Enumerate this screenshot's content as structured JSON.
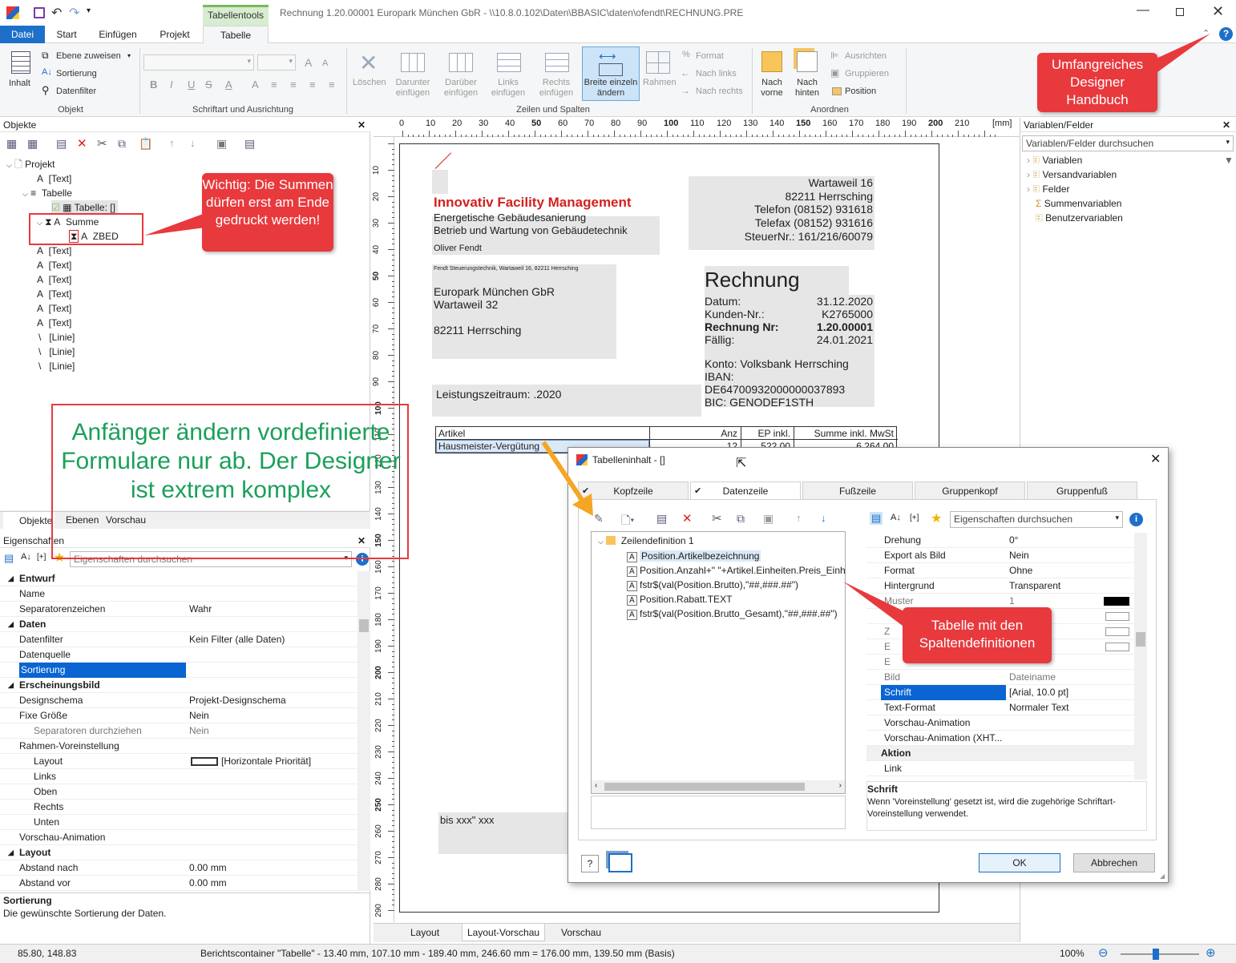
{
  "window": {
    "title": "Rechnung 1.20.00001 Europark München GbR - \\\\10.8.0.102\\Daten\\BBASIC\\daten\\ofendt\\RECHNUNG.PRE",
    "contextual_tab": "Tabellentools"
  },
  "ribbon_tabs": [
    "Datei",
    "Start",
    "Einfügen",
    "Projekt",
    "Tabelle"
  ],
  "ribbon": {
    "objekt": {
      "group": "Objekt",
      "inhalt": "Inhalt",
      "ebene": "Ebene zuweisen",
      "sortierung": "Sortierung",
      "datenfilter": "Datenfilter"
    },
    "schrift": {
      "group": "Schriftart und Ausrichtung",
      "bold": "B",
      "italic": "I",
      "underline": "U",
      "strike": "S",
      "fontcolor": "A",
      "grow": "A",
      "shrink": "A"
    },
    "zeilen": {
      "group": "Zeilen und Spalten",
      "loeschen": "Löschen",
      "darunter": "Darunter einfügen",
      "darueber": "Darüber einfügen",
      "links": "Links einfügen",
      "rechts": "Rechts einfügen",
      "breite": "Breite einzeln ändern",
      "rahmen": "Rahmen",
      "format": "Format",
      "nachlinks": "Nach links",
      "nachrechts": "Nach rechts"
    },
    "anordnen": {
      "group": "Anordnen",
      "vorne": "Nach vorne",
      "hinten": "Nach hinten",
      "ausrichten": "Ausrichten",
      "gruppieren": "Gruppieren",
      "position": "Position"
    }
  },
  "objects_panel": {
    "title": "Objekte",
    "tree": [
      "Projekt",
      "[Text]",
      "Tabelle",
      "Tabelle: []",
      "Summe",
      "ZBED",
      "[Text]",
      "[Text]",
      "[Text]",
      "[Text]",
      "[Text]",
      "[Text]",
      "[Linie]",
      "[Linie]",
      "[Linie]"
    ],
    "tabs": [
      "Objekte",
      "Ebenen",
      "Vorschau"
    ]
  },
  "props_panel": {
    "title": "Eigenschaften",
    "search": "Eigenschaften durchsuchen",
    "rows": [
      {
        "k": "Entwurf",
        "v": "",
        "cat": true
      },
      {
        "k": "Name",
        "v": ""
      },
      {
        "k": "Separatorenzeichen",
        "v": "Wahr"
      },
      {
        "k": "Daten",
        "v": "",
        "cat": true
      },
      {
        "k": "Datenfilter",
        "v": "Kein Filter (alle Daten)"
      },
      {
        "k": "Datenquelle",
        "v": ""
      },
      {
        "k": "Sortierung",
        "v": "",
        "sel": true
      },
      {
        "k": "Erscheinungsbild",
        "v": "",
        "cat": true
      },
      {
        "k": "Designschema",
        "v": "Projekt-Designschema"
      },
      {
        "k": "Fixe Größe",
        "v": "Nein"
      },
      {
        "k": "Separatoren durchziehen",
        "v": "Nein",
        "sub": true
      },
      {
        "k": "Rahmen-Voreinstellung",
        "v": ""
      },
      {
        "k": "Layout",
        "v": "[Horizontale Priorität]",
        "sub": true
      },
      {
        "k": "Links",
        "v": "",
        "sub": true
      },
      {
        "k": "Oben",
        "v": "",
        "sub": true
      },
      {
        "k": "Rechts",
        "v": "",
        "sub": true
      },
      {
        "k": "Unten",
        "v": "",
        "sub": true
      },
      {
        "k": "Vorschau-Animation",
        "v": ""
      },
      {
        "k": "Layout",
        "v": "",
        "cat": true
      },
      {
        "k": "Abstand nach",
        "v": "0.00 mm"
      },
      {
        "k": "Abstand vor",
        "v": "0.00 mm"
      }
    ],
    "desc_title": "Sortierung",
    "desc": "Die gewünschte Sortierung der Daten."
  },
  "vars_panel": {
    "title": "Variablen/Felder",
    "search": "Variablen/Felder durchsuchen",
    "items": [
      "Variablen",
      "Versandvariablen",
      "Felder",
      "Summenvariablen",
      "Benutzervariablen"
    ]
  },
  "ruler": {
    "unit": "[mm]",
    "ticks": [
      "0",
      "10",
      "20",
      "30",
      "40",
      "50",
      "60",
      "70",
      "80",
      "90",
      "100",
      "110",
      "120",
      "130",
      "140",
      "150",
      "160",
      "170",
      "180",
      "190",
      "200",
      "210"
    ],
    "vticks": [
      "10",
      "20",
      "30",
      "40",
      "50",
      "60",
      "70",
      "80",
      "90",
      "100",
      "110",
      "120",
      "130",
      "140",
      "150",
      "160",
      "170",
      "180",
      "190",
      "200",
      "210",
      "220",
      "230",
      "240",
      "250",
      "260",
      "270",
      "280",
      "290"
    ]
  },
  "doc": {
    "company": "Innovativ Facility Management",
    "line1": "Energetische Gebäudesanierung",
    "line2": "Betrieb und Wartung von Gebäudetechnik",
    "contact": "Oliver Fendt",
    "addr": [
      "Wartaweil 16",
      "82211 Herrsching",
      "Telefon (08152) 931618",
      "Telefax (08152) 931616",
      "SteuerNr.: 161/216/60079"
    ],
    "sender": "Fendt Steuerungstechnik, Wartaweil 16, 82211 Herrsching",
    "recipient": [
      "Europark München GbR",
      "Wartaweil 32",
      "",
      "82211 Herrsching"
    ],
    "heading": "Rechnung",
    "meta": [
      [
        "Datum:",
        "31.12.2020"
      ],
      [
        "Kunden-Nr.:",
        "K2765000"
      ],
      [
        "Rechnung Nr:",
        "1.20.00001"
      ],
      [
        "Fällig:",
        "24.01.2021"
      ]
    ],
    "bank": [
      "Konto: Volksbank Herrsching",
      "IBAN:",
      "DE64700932000000037893",
      "BIC: GENODEF1STH"
    ],
    "leistung": "Leistungszeitraum: .2020",
    "table_head": [
      "Artikel",
      "Anz",
      "EP inkl.",
      "Summe inkl. MwSt"
    ],
    "table_row": [
      "Hausmeister-Vergütung",
      "12",
      "522,00",
      "6.264,00"
    ],
    "footer": "bis xxx\" xxx"
  },
  "bottom_tabs": [
    "Layout",
    "Layout-Vorschau",
    "Vorschau"
  ],
  "dialog": {
    "title": "Tabelleninhalt - []",
    "tabs": [
      "Kopfzeile",
      "Datenzeile",
      "Fußzeile",
      "Gruppenkopf",
      "Gruppenfuß"
    ],
    "tree_root": "Zeilendefinition  1",
    "tree_items": [
      "Position.Artikelbezeichnung",
      "Position.Anzahl+\" \"+Artikel.Einheiten.Preis_Einh",
      "fstr$(val(Position.Brutto),\"##,###.##\")",
      "Position.Rabatt.TEXT",
      "fstr$(val(Position.Brutto_Gesamt),\"##,###.##\")"
    ],
    "search": "Eigenschaften durchsuchen",
    "props": [
      {
        "k": "Drehung",
        "v": "0°"
      },
      {
        "k": "Export als Bild",
        "v": "Nein"
      },
      {
        "k": "Format",
        "v": "Ohne"
      },
      {
        "k": "Hintergrund",
        "v": "Transparent"
      },
      {
        "k": "Muster",
        "v": "1"
      },
      {
        "k": "",
        "v": "ne.Back..."
      },
      {
        "k": "Z",
        "v": "White"
      },
      {
        "k": "E",
        "v": "White"
      },
      {
        "k": "E",
        "v": ""
      },
      {
        "k": "Bild",
        "v": "Dateiname"
      },
      {
        "k": "Schrift",
        "v": "[Arial, 10.0 pt]",
        "sel": true
      },
      {
        "k": "Text-Format",
        "v": "Normaler Text"
      },
      {
        "k": "Vorschau-Animation",
        "v": ""
      },
      {
        "k": "Vorschau-Animation (XHT...",
        "v": ""
      },
      {
        "k": "Aktion",
        "v": "",
        "cat": true
      },
      {
        "k": "Link",
        "v": ""
      }
    ],
    "desc_title": "Schrift",
    "desc": "Wenn 'Voreinstellung' gesetzt ist, wird die zugehörige Schriftart-Voreinstellung verwendet.",
    "ok": "OK",
    "cancel": "Abbrechen"
  },
  "callouts": {
    "handbuch": "Umfangreiches Designer Handbuch",
    "summen": "Wichtig: Die Summen dürfen erst am Ende gedruckt werden!",
    "spalten": "Tabelle mit den Spaltendefinitionen",
    "anfaenger": "Anfänger ändern vordefinierte Formulare nur ab. Der Designer ist extrem komplex"
  },
  "status": {
    "coords": "85.80, 148.83",
    "info": "Berichtscontainer \"Tabelle\"  -  13.40 mm, 107.10 mm  -  189.40 mm, 246.60 mm  =  176.00 mm, 139.50 mm (Basis)",
    "zoom": "100%"
  },
  "colors": {
    "accent": "#1e6fc8",
    "callout": "#e8393d",
    "select": "#0a64d2",
    "green_text": "#1aa05a",
    "company": "#d42020"
  }
}
